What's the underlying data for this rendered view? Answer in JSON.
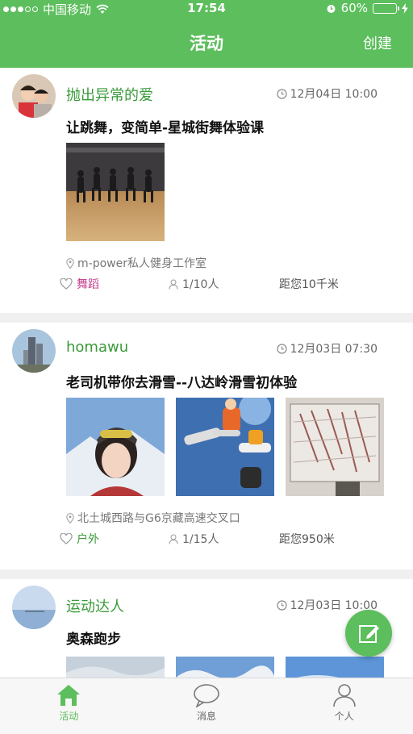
{
  "status_bar": {
    "carrier": "中国移动",
    "time": "17:54",
    "battery": "60%",
    "battery_level": 0.6
  },
  "nav": {
    "title": "活动",
    "create_label": "创建"
  },
  "activities": [
    {
      "user": "抛出异常的爱",
      "time": "12月04日 10:00",
      "title": "让跳舞，变简单-星城街舞体验课",
      "location": "m-power私人健身工作室",
      "tag": "舞蹈",
      "people": "1/10人",
      "distance": "距您10千米"
    },
    {
      "user": "homawu",
      "time": "12月03日 07:30",
      "title": "老司机带你去滑雪--八达岭滑雪初体验",
      "location": "北土城西路与G6京藏高速交叉口",
      "tag": "户外",
      "people": "1/15人",
      "distance": "距您950米"
    },
    {
      "user": "运动达人",
      "time": "12月03日 10:00",
      "title": "奥森跑步"
    }
  ],
  "tabbar": {
    "items": [
      {
        "label": "活动",
        "icon": "home-icon",
        "active": true
      },
      {
        "label": "消息",
        "icon": "message-icon",
        "active": false
      },
      {
        "label": "个人",
        "icon": "person-icon",
        "active": false
      }
    ]
  },
  "colors": {
    "brand": "#5cbe5c",
    "username": "#3a9a3a",
    "tag_dance": "#c43b8c",
    "tag_outdoor": "#3a9a3a"
  }
}
